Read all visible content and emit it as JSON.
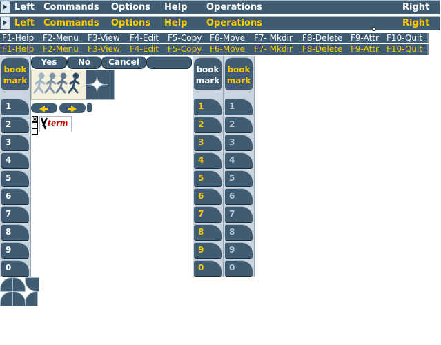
{
  "menubar_top": {
    "items": [
      "Left",
      "Commands",
      "Options",
      "Help",
      "Operations",
      "Right"
    ]
  },
  "menubar_bottom": {
    "items": [
      "Left",
      "Commands",
      "Options",
      "Help",
      "Operations",
      "Right"
    ]
  },
  "function_keys": [
    "F1-Help",
    "F2-Menu",
    "F3-View",
    "F4-Edit",
    "F5-Copy",
    "F6-Move",
    "F7- Mkdir",
    "F8-Delete",
    "F9-Attr",
    "F10-Quit"
  ],
  "dialog_buttons": {
    "yes": "Yes",
    "no": "No",
    "cancel": "Cancel"
  },
  "bookmark": {
    "line1": "book",
    "line2": "mark"
  },
  "bookmark_keys": [
    "1",
    "2",
    "3",
    "4",
    "5",
    "6",
    "7",
    "8",
    "9",
    "0"
  ],
  "xterm_label": "term",
  "colors": {
    "panel": "#3f5c72",
    "text_white": "#ffffff",
    "text_yellow": "#ffcc00",
    "bg": "#ffffff"
  }
}
